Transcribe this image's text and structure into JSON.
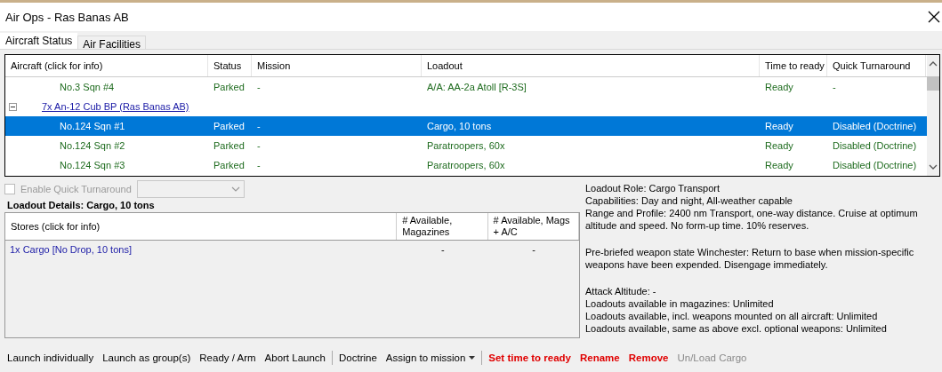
{
  "window": {
    "title": "Air Ops - Ras Banas AB"
  },
  "tabs": [
    {
      "label": "Aircraft Status",
      "selected": true
    },
    {
      "label": "Air Facilities",
      "selected": false
    }
  ],
  "aircraft_table": {
    "columns": [
      "Aircraft (click for info)",
      "Status",
      "Mission",
      "Loadout",
      "Time to ready",
      "Quick Turnaround"
    ],
    "rows": [
      {
        "kind": "unit",
        "selected": false,
        "cells": [
          "No.3 Sqn #4",
          "Parked",
          "-",
          "A/A: AA-2a Atoll [R-3S]",
          "Ready",
          "-"
        ]
      },
      {
        "kind": "group",
        "expanded": true,
        "selected": false,
        "label": "7x An-12 Cub BP (Ras Banas AB)"
      },
      {
        "kind": "unit",
        "selected": true,
        "cells": [
          "No.124 Sqn #1",
          "Parked",
          "-",
          "Cargo, 10 tons",
          "Ready",
          "Disabled (Doctrine)"
        ]
      },
      {
        "kind": "unit",
        "selected": false,
        "cells": [
          "No.124 Sqn #2",
          "Parked",
          "-",
          "Paratroopers, 60x",
          "Ready",
          "Disabled (Doctrine)"
        ]
      },
      {
        "kind": "unit",
        "selected": false,
        "cells": [
          "No.124 Sqn #3",
          "Parked",
          "-",
          "Paratroopers, 60x",
          "Ready",
          "Disabled (Doctrine)"
        ]
      }
    ]
  },
  "quick_turnaround": {
    "label": "Enable Quick Turnaround",
    "checked": false,
    "disabled": true
  },
  "loadout_details": {
    "title": "Loadout Details: Cargo, 10 tons",
    "columns": [
      "Stores (click for info)",
      "# Available, Magazines",
      "# Available, Mags + A/C"
    ],
    "rows": [
      [
        "1x Cargo [No Drop, 10 tons]",
        "-",
        "-"
      ]
    ]
  },
  "info": [
    [
      "Loadout Role: Cargo Transport",
      "Capabilities: Day and night, All-weather capable",
      "Range and Profile: 2400 nm Transport, one-way distance. Cruise at optimum altitude and speed. No form-up time. 10% reserves."
    ],
    [
      "Pre-briefed weapon state Winchester: Return to base when mission-specific weapons have been expended. Disengage immediately."
    ],
    [
      "Attack Altitude: -",
      "Loadouts available in magazines: Unlimited",
      "Loadouts available, incl. weapons mounted on all aircraft: Unlimited",
      "Loadouts available, same as above excl. optional weapons: Unlimited"
    ]
  ],
  "toolbar": [
    [
      {
        "label": "Launch individually",
        "kind": "normal"
      },
      {
        "label": "Launch as group(s)",
        "kind": "normal"
      },
      {
        "label": "Ready / Arm",
        "kind": "normal"
      },
      {
        "label": "Abort Launch",
        "kind": "normal"
      }
    ],
    [
      {
        "label": "Doctrine",
        "kind": "normal"
      },
      {
        "label": "Assign to mission",
        "kind": "dropdown"
      }
    ],
    [
      {
        "label": "Set time to ready",
        "kind": "danger"
      },
      {
        "label": "Rename",
        "kind": "danger"
      },
      {
        "label": "Remove",
        "kind": "danger"
      },
      {
        "label": "Un/Load Cargo",
        "kind": "disabled"
      }
    ]
  ]
}
